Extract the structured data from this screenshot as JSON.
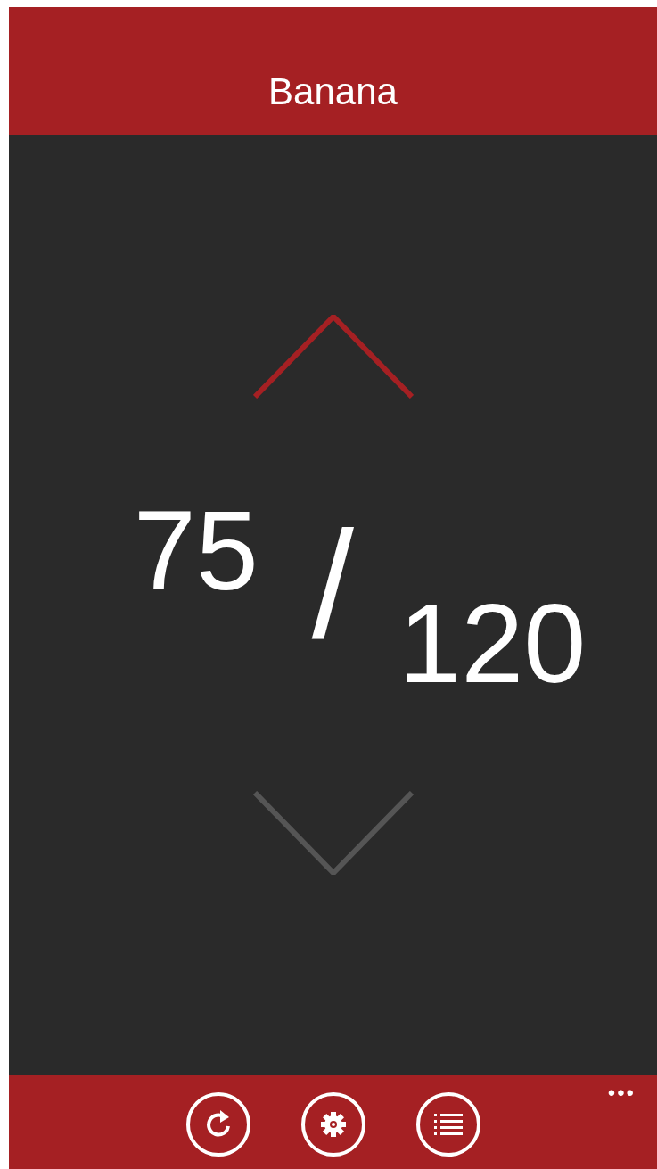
{
  "header": {
    "title": "Banana"
  },
  "counter": {
    "current": "75",
    "separator": "/",
    "total": "120",
    "arrows": [
      {
        "kind": "up",
        "disabled": false
      },
      {
        "kind": "down",
        "disabled": true
      }
    ]
  },
  "app_bar": {
    "buttons": [
      {
        "kind": "refresh"
      },
      {
        "kind": "settings"
      },
      {
        "kind": "list"
      }
    ],
    "more": "•••"
  }
}
